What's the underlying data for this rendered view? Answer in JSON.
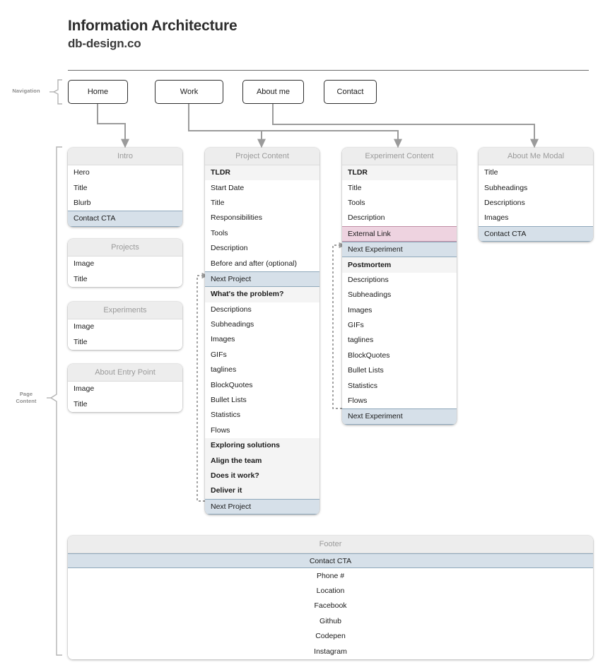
{
  "header": {
    "title": "Information Architecture",
    "subtitle": "db-design.co"
  },
  "braces": {
    "navigation": "Navigation",
    "page_content_line1": "Page",
    "page_content_line2": "Content"
  },
  "nav": {
    "items": [
      {
        "label": "Home"
      },
      {
        "label": "Work"
      },
      {
        "label": "About me"
      },
      {
        "label": "Contact"
      }
    ]
  },
  "colors": {
    "highlight_blue": "#d6e0e9",
    "highlight_blue_border": "#8fa8bb",
    "highlight_pink": "#eed3e0",
    "highlight_pink_border": "#c08fa6",
    "card_header_bg": "#ededed",
    "section_row_bg": "#f4f4f4",
    "card_header_text": "#9a9a9a",
    "title_text": "#2d2d2d",
    "rule": "#6b6b6b",
    "wire": "#9b9b9b",
    "nav_border": "#2f2f2f"
  },
  "cards": {
    "intro": {
      "title": "Intro",
      "rows": [
        {
          "label": "Hero",
          "style": "normal"
        },
        {
          "label": "Title",
          "style": "normal"
        },
        {
          "label": "Blurb",
          "style": "normal"
        },
        {
          "label": "Contact CTA",
          "style": "hl-blue"
        }
      ]
    },
    "projects": {
      "title": "Projects",
      "rows": [
        {
          "label": "Image",
          "style": "normal"
        },
        {
          "label": "Title",
          "style": "normal"
        }
      ]
    },
    "experiments": {
      "title": "Experiments",
      "rows": [
        {
          "label": "Image",
          "style": "normal"
        },
        {
          "label": "Title",
          "style": "normal"
        }
      ]
    },
    "about_entry_point": {
      "title": "About Entry Point",
      "rows": [
        {
          "label": "Image",
          "style": "normal"
        },
        {
          "label": "Title",
          "style": "normal"
        }
      ]
    },
    "project_content": {
      "title": "Project Content",
      "rows": [
        {
          "label": "TLDR",
          "style": "section"
        },
        {
          "label": "Start Date",
          "style": "normal"
        },
        {
          "label": "Title",
          "style": "normal"
        },
        {
          "label": "Responsibilities",
          "style": "normal"
        },
        {
          "label": "Tools",
          "style": "normal"
        },
        {
          "label": "Description",
          "style": "normal"
        },
        {
          "label": "Before and after (optional)",
          "style": "normal"
        },
        {
          "label": "Next Project",
          "style": "hl-blue"
        },
        {
          "label": "What's the problem?",
          "style": "section"
        },
        {
          "label": "Descriptions",
          "style": "normal"
        },
        {
          "label": "Subheadings",
          "style": "normal"
        },
        {
          "label": "Images",
          "style": "normal"
        },
        {
          "label": "GIFs",
          "style": "normal"
        },
        {
          "label": "taglines",
          "style": "normal"
        },
        {
          "label": "BlockQuotes",
          "style": "normal"
        },
        {
          "label": "Bullet Lists",
          "style": "normal"
        },
        {
          "label": "Statistics",
          "style": "normal"
        },
        {
          "label": "Flows",
          "style": "normal"
        },
        {
          "label": "Exploring solutions",
          "style": "section"
        },
        {
          "label": "Align the team",
          "style": "section"
        },
        {
          "label": "Does it work?",
          "style": "section"
        },
        {
          "label": "Deliver it",
          "style": "section"
        },
        {
          "label": "Next Project",
          "style": "hl-blue"
        }
      ]
    },
    "experiment_content": {
      "title": "Experiment Content",
      "rows": [
        {
          "label": "TLDR",
          "style": "section"
        },
        {
          "label": "Title",
          "style": "normal"
        },
        {
          "label": "Tools",
          "style": "normal"
        },
        {
          "label": "Description",
          "style": "normal"
        },
        {
          "label": "External Link",
          "style": "hl-pink"
        },
        {
          "label": "Next Experiment",
          "style": "hl-blue"
        },
        {
          "label": "Postmortem",
          "style": "section"
        },
        {
          "label": "Descriptions",
          "style": "normal"
        },
        {
          "label": "Subheadings",
          "style": "normal"
        },
        {
          "label": "Images",
          "style": "normal"
        },
        {
          "label": "GIFs",
          "style": "normal"
        },
        {
          "label": "taglines",
          "style": "normal"
        },
        {
          "label": "BlockQuotes",
          "style": "normal"
        },
        {
          "label": "Bullet Lists",
          "style": "normal"
        },
        {
          "label": "Statistics",
          "style": "normal"
        },
        {
          "label": "Flows",
          "style": "normal"
        },
        {
          "label": "Next Experiment",
          "style": "hl-blue"
        }
      ]
    },
    "about_me_modal": {
      "title": "About Me Modal",
      "rows": [
        {
          "label": "Title",
          "style": "normal"
        },
        {
          "label": "Subheadings",
          "style": "normal"
        },
        {
          "label": "Descriptions",
          "style": "normal"
        },
        {
          "label": "Images",
          "style": "normal"
        },
        {
          "label": "Contact CTA",
          "style": "hl-blue"
        }
      ]
    },
    "footer": {
      "title": "Footer",
      "rows": [
        {
          "label": "Contact CTA",
          "style": "hl-blue"
        },
        {
          "label": "Phone #",
          "style": "normal"
        },
        {
          "label": "Location",
          "style": "normal"
        },
        {
          "label": "Facebook",
          "style": "normal"
        },
        {
          "label": "Github",
          "style": "normal"
        },
        {
          "label": "Codepen",
          "style": "normal"
        },
        {
          "label": "Instagram",
          "style": "normal"
        }
      ]
    }
  }
}
